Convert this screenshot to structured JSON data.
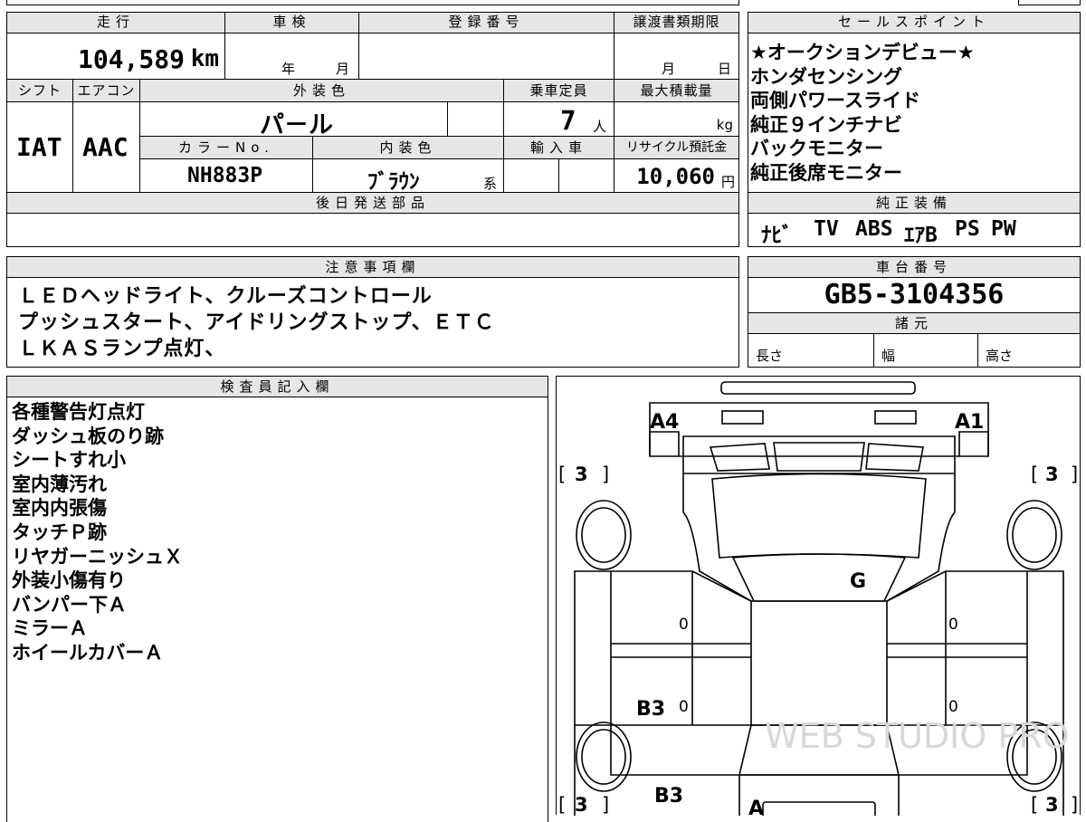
{
  "top_left": {
    "mileage": {
      "label": "走行",
      "value": "104,589",
      "unit": "km"
    },
    "inspection": {
      "label": "車検",
      "year_unit": "年",
      "month_unit": "月"
    },
    "registration": {
      "label": "登録番号",
      "value": ""
    },
    "transfer_deadline": {
      "label": "譲渡書類期限",
      "month_unit": "月",
      "day_unit": "日"
    },
    "shift": {
      "label": "シフト",
      "value": "IAT"
    },
    "aircon": {
      "label": "エアコン",
      "value": "AAC"
    },
    "exterior_color": {
      "label": "外装色",
      "value": "パ－ル"
    },
    "seating": {
      "label": "乗車定員",
      "value": "7",
      "unit": "人"
    },
    "max_load": {
      "label": "最大積載量",
      "unit": "kg"
    },
    "color_no": {
      "label": "カラーNo.",
      "value": "NH883P"
    },
    "interior_color": {
      "label": "内装色",
      "value": "ﾌﾞﾗｳﾝ",
      "unit": "系"
    },
    "import": {
      "label": "輸入車"
    },
    "recycle": {
      "label": "リサイクル預託金",
      "value": "10,060",
      "unit": "円"
    },
    "later_parts": {
      "label": "後日発送部品"
    }
  },
  "sales_points": {
    "label": "セールスポイント",
    "items": [
      "★オークションデビュー★",
      "ホンダセンシング",
      "両側パワースライド",
      "純正９インチナビ",
      "バックモニター",
      "純正後席モニター"
    ]
  },
  "standard_equipment": {
    "label": "純正装備",
    "items": [
      "ﾅﾋﾞ",
      "TV",
      "ABS",
      "ｴｱB",
      "PS",
      "PW"
    ]
  },
  "notes": {
    "label": "注意事項欄",
    "lines": [
      "ＬＥＤヘッドライト、クルーズコントロール",
      "プッシュスタート、アイドリングストップ、ＥＴＣ",
      "ＬＫＡＳランプ点灯、"
    ]
  },
  "chassis": {
    "label": "車台番号",
    "value": "GB5-3104356"
  },
  "specs": {
    "label": "諸元",
    "length": "長さ",
    "width": "幅",
    "height": "高さ"
  },
  "inspector": {
    "label": "検査員記入欄",
    "lines": [
      "各種警告灯点灯",
      "ダッシュ板のり跡",
      "シートすれ小",
      "室内薄汚れ",
      "室内内張傷",
      "タッチＰ跡",
      "リヤガーニッシュＸ",
      "外装小傷有り",
      "バンパー下Ａ",
      "ミラーＡ",
      "ホイールカバーＡ"
    ]
  },
  "diagram": {
    "marks": {
      "a4": "A4",
      "a1": "A1",
      "g": "G",
      "b3_mid": "B3",
      "b3_low": "B3",
      "a_bottom": "A"
    },
    "tires": {
      "front_left": "3",
      "front_right": "3",
      "rear_left": "3",
      "rear_right": "3"
    },
    "panels": {
      "left_front": "0",
      "left_rear": "0",
      "right_front": "0",
      "right_rear": "0"
    },
    "bracket_open": "[",
    "bracket_close": "]",
    "watermark": "WEB STUDIO PRO"
  }
}
